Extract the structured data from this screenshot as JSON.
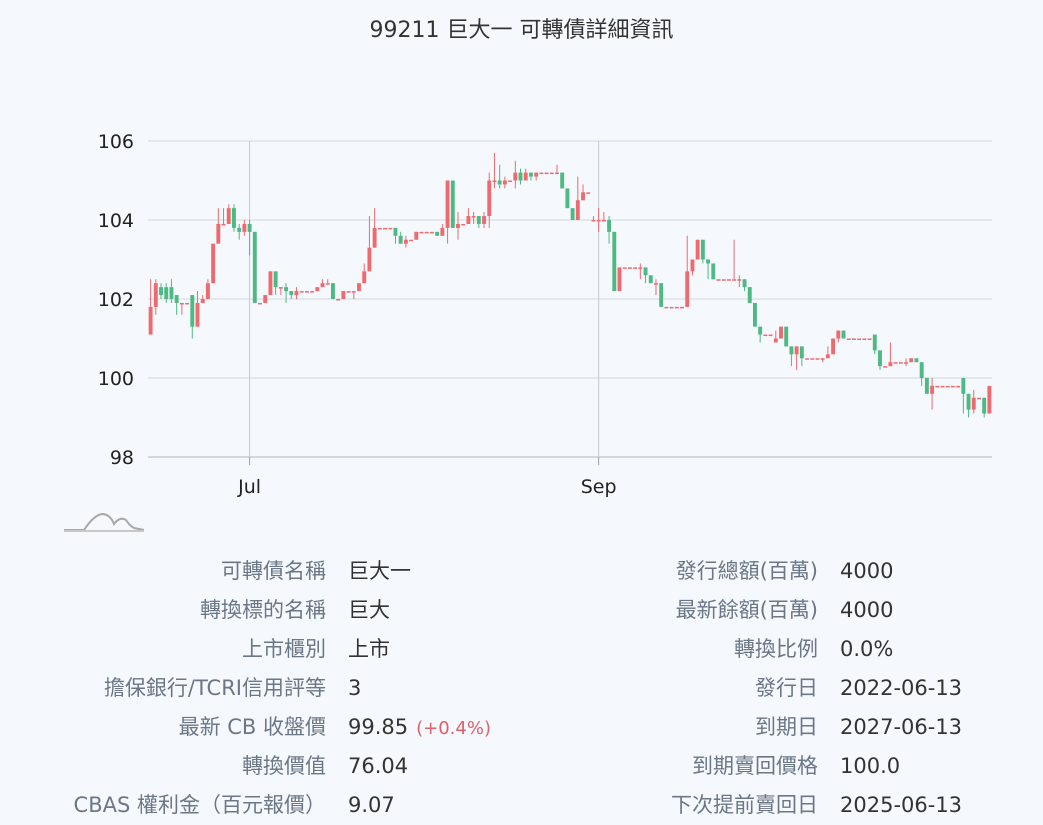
{
  "title": "99211 巨大一 可轉債詳細資訊",
  "chart_data": {
    "type": "candlestick",
    "ylim": [
      98,
      106
    ],
    "yticks": [
      98,
      100,
      102,
      104,
      106
    ],
    "xticks": [
      {
        "label": "Jul",
        "index": 19
      },
      {
        "label": "Sep",
        "index": 86
      }
    ],
    "up_color": "#ee6a6f",
    "down_color": "#4cba82",
    "candles": [
      [
        101.1,
        101.8,
        101.1,
        101.8,
        102.5
      ],
      [
        101.8,
        102.4,
        101.6,
        102.4,
        102.5
      ],
      [
        102.3,
        102.1,
        102.0,
        102.3,
        102.4
      ],
      [
        102.3,
        102.0,
        101.9,
        102.3,
        102.4
      ],
      [
        102.3,
        102.0,
        101.9,
        102.3,
        102.5
      ],
      [
        102.1,
        101.9,
        101.6,
        102.1,
        102.1
      ],
      [
        101.9,
        101.9,
        101.6,
        101.9,
        101.9
      ],
      [
        101.9,
        101.9,
        101.9,
        101.9,
        101.9
      ],
      [
        102.1,
        101.3,
        101.0,
        102.1,
        102.1
      ],
      [
        101.3,
        101.9,
        101.3,
        101.9,
        102.2
      ],
      [
        101.9,
        102.0,
        101.9,
        102.0,
        102.1
      ],
      [
        102.0,
        102.4,
        102.0,
        102.4,
        102.5
      ],
      [
        102.4,
        103.4,
        102.4,
        103.4,
        103.4
      ],
      [
        103.4,
        103.9,
        103.4,
        103.9,
        104.3
      ],
      [
        103.9,
        103.9,
        103.9,
        103.9,
        104.3
      ],
      [
        103.9,
        104.3,
        103.9,
        104.3,
        104.4
      ],
      [
        104.3,
        103.8,
        103.7,
        104.3,
        104.4
      ],
      [
        103.8,
        103.7,
        103.5,
        103.8,
        103.9
      ],
      [
        103.7,
        103.9,
        103.6,
        103.9,
        104.0
      ],
      [
        103.9,
        103.7,
        103.1,
        103.9,
        104.0
      ],
      [
        103.7,
        101.9,
        101.9,
        103.7,
        103.7
      ],
      [
        101.9,
        101.9,
        101.9,
        101.9,
        101.9
      ],
      [
        101.9,
        102.1,
        101.9,
        102.1,
        102.1
      ],
      [
        102.1,
        102.7,
        102.1,
        102.7,
        102.7
      ],
      [
        102.7,
        102.3,
        102.1,
        102.7,
        102.7
      ],
      [
        102.3,
        102.3,
        102.1,
        102.3,
        102.3
      ],
      [
        102.3,
        102.2,
        101.9,
        102.3,
        102.4
      ],
      [
        102.2,
        102.1,
        102.0,
        102.2,
        102.2
      ],
      [
        102.1,
        102.2,
        102.0,
        102.2,
        102.3
      ],
      [
        102.2,
        102.2,
        102.2,
        102.2,
        102.2
      ],
      [
        102.2,
        102.2,
        102.2,
        102.2,
        102.2
      ],
      [
        102.2,
        102.2,
        102.2,
        102.2,
        102.2
      ],
      [
        102.2,
        102.3,
        102.2,
        102.3,
        102.3
      ],
      [
        102.3,
        102.4,
        102.3,
        102.4,
        102.5
      ],
      [
        102.4,
        102.4,
        102.4,
        102.4,
        102.5
      ],
      [
        102.4,
        102.0,
        102.0,
        102.4,
        102.4
      ],
      [
        102.0,
        102.0,
        102.0,
        102.0,
        102.0
      ],
      [
        102.0,
        102.2,
        102.0,
        102.2,
        102.2
      ],
      [
        102.2,
        102.2,
        102.2,
        102.2,
        102.2
      ],
      [
        102.2,
        102.2,
        102.0,
        102.2,
        102.2
      ],
      [
        102.2,
        102.4,
        102.2,
        102.4,
        102.4
      ],
      [
        102.4,
        102.7,
        102.4,
        102.7,
        102.9
      ],
      [
        102.7,
        103.3,
        102.7,
        103.3,
        104.1
      ],
      [
        103.3,
        103.8,
        103.3,
        103.8,
        104.3
      ],
      [
        103.8,
        103.8,
        103.8,
        103.8,
        103.8
      ],
      [
        103.8,
        103.8,
        103.8,
        103.8,
        103.8
      ],
      [
        103.8,
        103.8,
        103.8,
        103.8,
        103.8
      ],
      [
        103.8,
        103.6,
        103.4,
        103.8,
        103.8
      ],
      [
        103.6,
        103.4,
        103.4,
        103.6,
        103.7
      ],
      [
        103.4,
        103.5,
        103.3,
        103.5,
        103.6
      ],
      [
        103.5,
        103.5,
        103.5,
        103.5,
        103.5
      ],
      [
        103.5,
        103.7,
        103.5,
        103.7,
        103.7
      ],
      [
        103.7,
        103.7,
        103.7,
        103.7,
        103.7
      ],
      [
        103.7,
        103.7,
        103.7,
        103.7,
        103.7
      ],
      [
        103.7,
        103.7,
        103.7,
        103.7,
        103.7
      ],
      [
        103.7,
        103.6,
        103.6,
        103.7,
        103.7
      ],
      [
        103.6,
        103.8,
        103.6,
        103.8,
        103.9
      ],
      [
        103.8,
        105.0,
        103.4,
        105.0,
        105.0
      ],
      [
        105.0,
        103.8,
        103.8,
        105.0,
        105.0
      ],
      [
        103.8,
        103.9,
        103.5,
        103.9,
        104.2
      ],
      [
        103.9,
        103.9,
        103.9,
        103.9,
        103.9
      ],
      [
        103.9,
        104.1,
        103.9,
        104.1,
        104.3
      ],
      [
        104.1,
        104.1,
        103.9,
        104.1,
        104.2
      ],
      [
        104.1,
        103.9,
        103.8,
        104.1,
        104.1
      ],
      [
        103.9,
        104.1,
        103.8,
        104.1,
        104.2
      ],
      [
        104.1,
        105.0,
        103.8,
        105.0,
        105.2
      ],
      [
        105.0,
        105.0,
        104.8,
        105.0,
        105.7
      ],
      [
        105.0,
        104.9,
        104.8,
        105.0,
        105.4
      ],
      [
        104.9,
        105.0,
        104.8,
        105.0,
        105.1
      ],
      [
        105.0,
        105.0,
        105.0,
        105.0,
        105.0
      ],
      [
        105.0,
        105.2,
        104.8,
        105.2,
        105.5
      ],
      [
        105.2,
        105.0,
        104.9,
        105.2,
        105.3
      ],
      [
        105.0,
        105.2,
        105.0,
        105.2,
        105.3
      ],
      [
        105.2,
        105.1,
        105.0,
        105.2,
        105.2
      ],
      [
        105.1,
        105.2,
        105.0,
        105.2,
        105.2
      ],
      [
        105.2,
        105.2,
        105.2,
        105.2,
        105.2
      ],
      [
        105.2,
        105.2,
        105.2,
        105.2,
        105.2
      ],
      [
        105.2,
        105.2,
        105.2,
        105.2,
        105.2
      ],
      [
        105.2,
        105.2,
        105.2,
        105.2,
        105.4
      ],
      [
        105.2,
        104.8,
        104.8,
        105.2,
        105.2
      ],
      [
        104.8,
        104.3,
        104.3,
        104.8,
        104.8
      ],
      [
        104.3,
        104.0,
        104.0,
        104.3,
        104.3
      ],
      [
        104.0,
        104.5,
        104.0,
        104.5,
        105.1
      ],
      [
        104.5,
        104.7,
        104.5,
        104.7,
        104.9
      ],
      [
        104.7,
        104.7,
        104.7,
        104.7,
        104.7
      ],
      [
        104.0,
        104.0,
        104.0,
        104.0,
        104.1
      ],
      [
        104.0,
        104.0,
        103.7,
        104.0,
        104.3
      ],
      [
        104.0,
        104.0,
        104.0,
        104.0,
        104.2
      ],
      [
        104.0,
        103.7,
        103.4,
        104.0,
        104.1
      ],
      [
        103.7,
        102.2,
        102.2,
        103.7,
        103.7
      ],
      [
        102.2,
        102.8,
        102.2,
        102.8,
        102.8
      ],
      [
        102.8,
        102.8,
        102.8,
        102.8,
        102.8
      ],
      [
        102.8,
        102.8,
        102.8,
        102.8,
        102.8
      ],
      [
        102.8,
        102.8,
        102.8,
        102.8,
        102.8
      ],
      [
        102.8,
        102.8,
        102.5,
        102.8,
        102.9
      ],
      [
        102.8,
        102.6,
        102.4,
        102.8,
        102.8
      ],
      [
        102.6,
        102.4,
        102.4,
        102.6,
        102.6
      ],
      [
        102.4,
        102.4,
        102.1,
        102.4,
        102.5
      ],
      [
        102.4,
        101.8,
        101.8,
        102.4,
        102.4
      ],
      [
        101.8,
        101.8,
        101.8,
        101.8,
        101.8
      ],
      [
        101.8,
        101.8,
        101.8,
        101.8,
        101.8
      ],
      [
        101.8,
        101.8,
        101.8,
        101.8,
        101.8
      ],
      [
        101.8,
        101.8,
        101.8,
        101.8,
        101.8
      ],
      [
        101.8,
        102.7,
        101.8,
        102.7,
        103.6
      ],
      [
        102.7,
        103.0,
        102.6,
        103.0,
        103.0
      ],
      [
        103.0,
        103.5,
        103.0,
        103.5,
        103.5
      ],
      [
        103.5,
        103.0,
        102.9,
        103.5,
        103.5
      ],
      [
        103.0,
        102.9,
        102.5,
        103.0,
        103.0
      ],
      [
        102.9,
        102.5,
        102.5,
        102.9,
        102.9
      ],
      [
        102.5,
        102.5,
        102.5,
        102.5,
        102.5
      ],
      [
        102.5,
        102.5,
        102.5,
        102.5,
        102.5
      ],
      [
        102.5,
        102.5,
        102.5,
        102.5,
        102.5
      ],
      [
        102.5,
        102.5,
        102.5,
        103.4,
        103.5
      ],
      [
        102.5,
        102.5,
        102.3,
        102.6,
        102.6
      ],
      [
        102.5,
        102.3,
        102.2,
        102.5,
        102.5
      ],
      [
        102.3,
        101.9,
        101.9,
        102.3,
        102.3
      ],
      [
        101.9,
        101.3,
        101.3,
        101.9,
        101.9
      ],
      [
        101.3,
        101.1,
        100.9,
        101.3,
        101.3
      ],
      [
        101.1,
        101.1,
        101.1,
        101.1,
        101.1
      ],
      [
        101.1,
        101.1,
        101.1,
        101.1,
        101.1
      ],
      [
        100.9,
        101.0,
        100.9,
        101.0,
        101.2
      ],
      [
        101.0,
        101.3,
        101.0,
        101.3,
        101.3
      ],
      [
        101.3,
        100.8,
        100.8,
        101.3,
        101.3
      ],
      [
        100.8,
        100.6,
        100.3,
        100.8,
        100.8
      ],
      [
        100.6,
        100.8,
        100.2,
        100.8,
        100.8
      ],
      [
        100.8,
        100.5,
        100.3,
        100.8,
        100.8
      ],
      [
        100.5,
        100.5,
        100.5,
        100.5,
        100.5
      ],
      [
        100.5,
        100.5,
        100.5,
        100.5,
        100.5
      ],
      [
        100.5,
        100.5,
        100.5,
        100.5,
        100.5
      ],
      [
        100.5,
        100.5,
        100.4,
        100.5,
        100.5
      ],
      [
        100.5,
        100.6,
        100.5,
        100.6,
        100.8
      ],
      [
        100.6,
        101.0,
        100.6,
        101.0,
        101.0
      ],
      [
        101.0,
        101.2,
        100.9,
        101.2,
        101.2
      ],
      [
        101.2,
        101.0,
        101.0,
        101.2,
        101.2
      ],
      [
        101.0,
        101.0,
        101.0,
        101.0,
        101.0
      ],
      [
        101.0,
        101.0,
        101.0,
        101.0,
        101.0
      ],
      [
        101.0,
        101.0,
        101.0,
        101.0,
        101.0
      ],
      [
        101.0,
        101.0,
        101.0,
        101.0,
        101.0
      ],
      [
        101.0,
        101.0,
        101.0,
        101.0,
        101.0
      ],
      [
        101.1,
        100.7,
        100.6,
        101.1,
        101.1
      ],
      [
        100.7,
        100.3,
        100.2,
        100.7,
        100.7
      ],
      [
        100.3,
        100.3,
        100.3,
        100.3,
        100.3
      ],
      [
        100.3,
        100.4,
        100.3,
        100.4,
        100.9
      ],
      [
        100.4,
        100.4,
        100.4,
        100.4,
        100.4
      ],
      [
        100.4,
        100.4,
        100.4,
        100.4,
        100.4
      ],
      [
        100.4,
        100.4,
        100.3,
        100.4,
        100.5
      ],
      [
        100.4,
        100.5,
        100.4,
        100.5,
        100.5
      ],
      [
        100.5,
        100.4,
        100.4,
        100.5,
        100.5
      ],
      [
        100.4,
        100.0,
        99.8,
        100.4,
        100.4
      ],
      [
        100.0,
        99.6,
        99.6,
        100.0,
        100.0
      ],
      [
        99.6,
        99.8,
        99.2,
        100.0,
        100.0
      ],
      [
        99.8,
        99.8,
        99.8,
        99.8,
        99.8
      ],
      [
        99.8,
        99.8,
        99.8,
        99.8,
        99.8
      ],
      [
        99.8,
        99.8,
        99.8,
        99.8,
        99.8
      ],
      [
        99.8,
        99.8,
        99.8,
        99.8,
        99.8
      ],
      [
        99.8,
        99.8,
        99.8,
        99.8,
        99.8
      ],
      [
        100.0,
        99.6,
        99.1,
        100.0,
        100.0
      ],
      [
        99.6,
        99.2,
        99.0,
        99.6,
        99.6
      ],
      [
        99.2,
        99.5,
        99.1,
        99.5,
        99.7
      ],
      [
        99.5,
        99.5,
        99.5,
        99.5,
        99.5
      ],
      [
        99.5,
        99.1,
        99.0,
        99.5,
        99.5
      ],
      [
        99.1,
        99.8,
        99.1,
        99.8,
        99.8
      ]
    ]
  },
  "info": {
    "left": [
      {
        "label": "可轉債名稱",
        "value": "巨大一"
      },
      {
        "label": "轉換標的名稱",
        "value": "巨大"
      },
      {
        "label": "上市櫃別",
        "value": "上市"
      },
      {
        "label": "擔保銀行/TCRI信用評等",
        "value": "3"
      },
      {
        "label": "最新 CB 收盤價",
        "value": "99.85",
        "change": "(+0.4%)"
      },
      {
        "label": "轉換價值",
        "value": "76.04"
      },
      {
        "label": "CBAS 權利金（百元報價）",
        "value": "9.07"
      }
    ],
    "right": [
      {
        "label": "發行總額(百萬)",
        "value": "4000"
      },
      {
        "label": "最新餘額(百萬)",
        "value": "4000"
      },
      {
        "label": "轉換比例",
        "value": "0.0%"
      },
      {
        "label": "發行日",
        "value": "2022-06-13"
      },
      {
        "label": "到期日",
        "value": "2027-06-13"
      },
      {
        "label": "到期賣回價格",
        "value": "100.0"
      },
      {
        "label": "下次提前賣回日",
        "value": "2025-06-13"
      }
    ]
  }
}
